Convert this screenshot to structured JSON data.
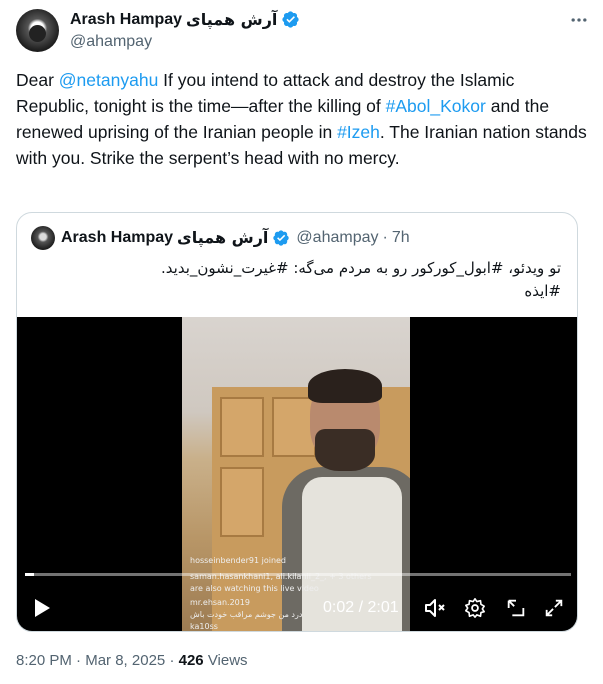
{
  "author": {
    "name": "Arash Hampay",
    "name_fa": "آرش همپای",
    "handle": "@ahampay"
  },
  "tweet": {
    "segments": [
      {
        "text": "Dear ",
        "link": false
      },
      {
        "text": "@netanyahu",
        "link": true
      },
      {
        "text": " If you intend to attack and destroy the Islamic Republic, tonight is the time—after the killing of ",
        "link": false
      },
      {
        "text": "#Abol_Kokor",
        "link": true
      },
      {
        "text": " and the renewed uprising of the Iranian people in ",
        "link": false
      },
      {
        "text": "#Izeh",
        "link": true
      },
      {
        "text": ". The Iranian nation stands with you. Strike the serpent’s head with no mercy.",
        "link": false
      }
    ]
  },
  "quote": {
    "name": "Arash Hampay",
    "name_fa": "آرش همپای",
    "handle": "@ahampay",
    "separator": "·",
    "time": "7h",
    "text_line1": "تو ویدئو، #ابول_کورکور رو به مردم می‌گه: #غیرت_نشون_بدید.",
    "text_line2": "#ایذه",
    "video": {
      "current_time": "0:02",
      "duration": "2:01",
      "time_separator": " / ",
      "progress": 0.017,
      "live_comments": [
        "hosseinbender91 joined",
        "saman.hasankhani1, ali.kilanii_2_, + 3 others",
        "are also watching this live video",
        "mr.ehsan.2019",
        "درد من جوشم مراقب خودت باش",
        "ka10ss"
      ]
    }
  },
  "meta": {
    "time": "8:20 PM",
    "dot": "·",
    "date": "Mar 8, 2025",
    "views_count": "426",
    "views_label": "Views"
  },
  "colors": {
    "link": "#1d9bf0",
    "verified": "#1d9bf0",
    "muted": "#536471",
    "text": "#0f1419",
    "border": "#cfd9de"
  },
  "icons": [
    "verified-icon",
    "more-icon",
    "play-icon",
    "mute-icon",
    "settings-icon",
    "pip-icon",
    "fullscreen-icon"
  ]
}
